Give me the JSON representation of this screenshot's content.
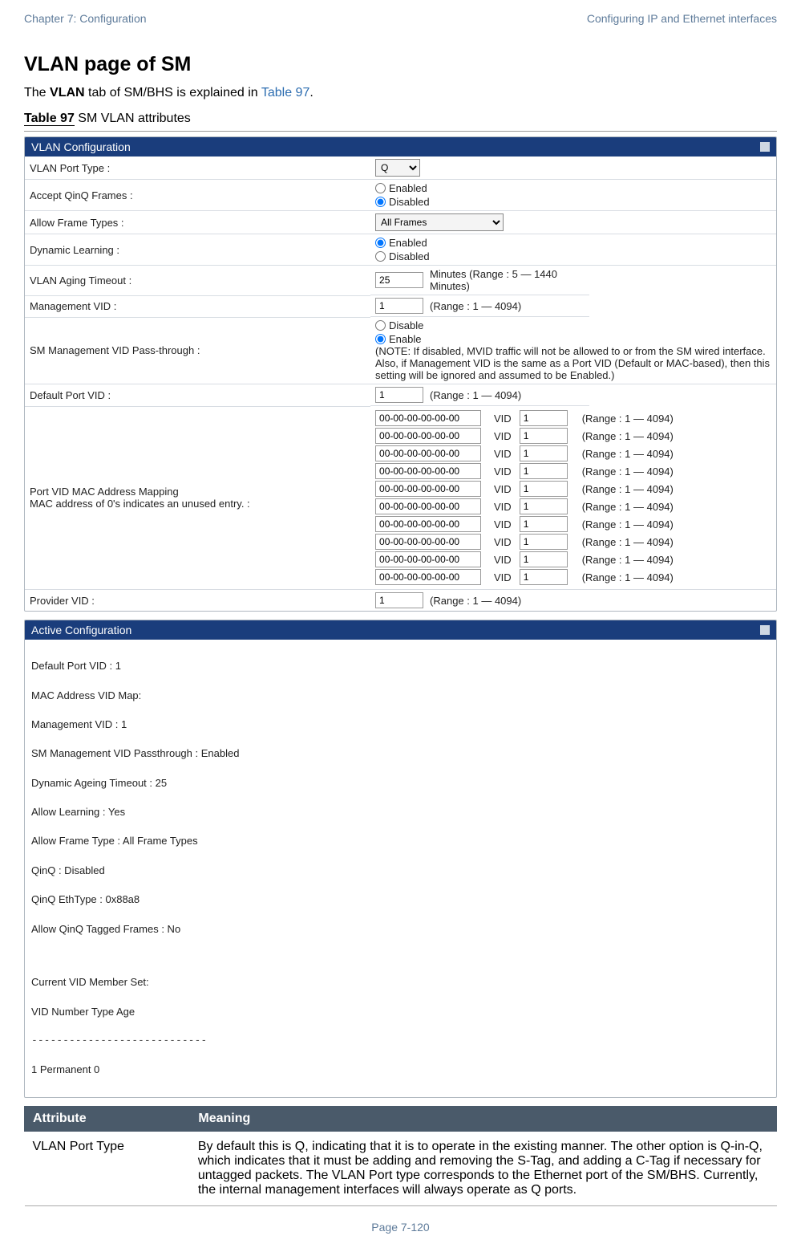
{
  "header": {
    "left": "Chapter 7:  Configuration",
    "right": "Configuring IP and Ethernet interfaces"
  },
  "title": "VLAN page of SM",
  "intro": {
    "pre": "The ",
    "bold": "VLAN",
    "mid": " tab of SM/BHS is explained in ",
    "link": "Table 97",
    "post": "."
  },
  "caption": {
    "bold": "Table 97",
    "rest": " SM VLAN attributes"
  },
  "panel1": {
    "title": "VLAN Configuration"
  },
  "rows": {
    "vlanPortType": {
      "label": "VLAN Port Type :",
      "value": "Q"
    },
    "acceptQinQ": {
      "label": "Accept QinQ Frames :",
      "enabled": "Enabled",
      "disabled": "Disabled"
    },
    "allowFrame": {
      "label": "Allow Frame Types :",
      "value": "All Frames"
    },
    "dynLearn": {
      "label": "Dynamic Learning :",
      "enabled": "Enabled",
      "disabled": "Disabled"
    },
    "aging": {
      "label": "VLAN Aging Timeout :",
      "value": "25",
      "range": "Minutes (Range : 5 — 1440 Minutes)"
    },
    "mgmtVid": {
      "label": "Management VID :",
      "value": "1",
      "range": "(Range : 1 — 4094)"
    },
    "smpass": {
      "label": "SM Management VID Pass-through :",
      "disable": "Disable",
      "enable": "Enable",
      "note": "(NOTE: If disabled, MVID traffic will not be allowed to or from the SM wired interface. Also, if Management VID is the same as a Port VID (Default or MAC-based), then this setting will be ignored and assumed to be Enabled.)"
    },
    "defPortVid": {
      "label": "Default Port VID :",
      "value": "1",
      "range": "(Range : 1 — 4094)"
    },
    "macmap": {
      "label": "Port VID MAC Address Mapping\nMAC address of 0's indicates an unused entry. :",
      "entries": [
        {
          "mac": "00-00-00-00-00-00",
          "vidlbl": "VID",
          "vid": "1",
          "range": "(Range : 1 — 4094)"
        },
        {
          "mac": "00-00-00-00-00-00",
          "vidlbl": "VID",
          "vid": "1",
          "range": "(Range : 1 — 4094)"
        },
        {
          "mac": "00-00-00-00-00-00",
          "vidlbl": "VID",
          "vid": "1",
          "range": "(Range : 1 — 4094)"
        },
        {
          "mac": "00-00-00-00-00-00",
          "vidlbl": "VID",
          "vid": "1",
          "range": "(Range : 1 — 4094)"
        },
        {
          "mac": "00-00-00-00-00-00",
          "vidlbl": "VID",
          "vid": "1",
          "range": "(Range : 1 — 4094)"
        },
        {
          "mac": "00-00-00-00-00-00",
          "vidlbl": "VID",
          "vid": "1",
          "range": "(Range : 1 — 4094)"
        },
        {
          "mac": "00-00-00-00-00-00",
          "vidlbl": "VID",
          "vid": "1",
          "range": "(Range : 1 — 4094)"
        },
        {
          "mac": "00-00-00-00-00-00",
          "vidlbl": "VID",
          "vid": "1",
          "range": "(Range : 1 — 4094)"
        },
        {
          "mac": "00-00-00-00-00-00",
          "vidlbl": "VID",
          "vid": "1",
          "range": "(Range : 1 — 4094)"
        },
        {
          "mac": "00-00-00-00-00-00",
          "vidlbl": "VID",
          "vid": "1",
          "range": "(Range : 1 — 4094)"
        }
      ]
    },
    "provVid": {
      "label": "Provider VID :",
      "value": "1",
      "range": "(Range : 1 — 4094)"
    }
  },
  "panel2": {
    "title": "Active Configuration"
  },
  "active": {
    "l1": "Default Port VID : 1",
    "l2": "MAC Address VID Map:",
    "l3": "Management VID : 1",
    "l4": "SM Management VID Passthrough : Enabled",
    "l5": "Dynamic Ageing Timeout : 25",
    "l6": "Allow Learning : Yes",
    "l7": "Allow Frame Type : All Frame Types",
    "l8": "QinQ : Disabled",
    "l9": "QinQ EthType : 0x88a8",
    "l10": "Allow QinQ Tagged Frames : No",
    "l11": "",
    "l12": "Current VID Member Set:",
    "l13": "VID Number   Type   Age",
    "l14": "----------------------------",
    "l15": "1     Permanent     0"
  },
  "attrTable": {
    "h1": "Attribute",
    "h2": "Meaning",
    "r1attr": "VLAN Port Type",
    "r1mean": "By default this is Q, indicating that it is to operate in the existing manner. The other option is Q-in-Q, which indicates that it must be adding and removing the S-Tag, and adding a C-Tag if necessary for untagged packets. The VLAN Port type corresponds to the Ethernet port of the SM/BHS. Currently, the internal management interfaces will always operate as Q ports."
  },
  "footer": "Page 7-120"
}
